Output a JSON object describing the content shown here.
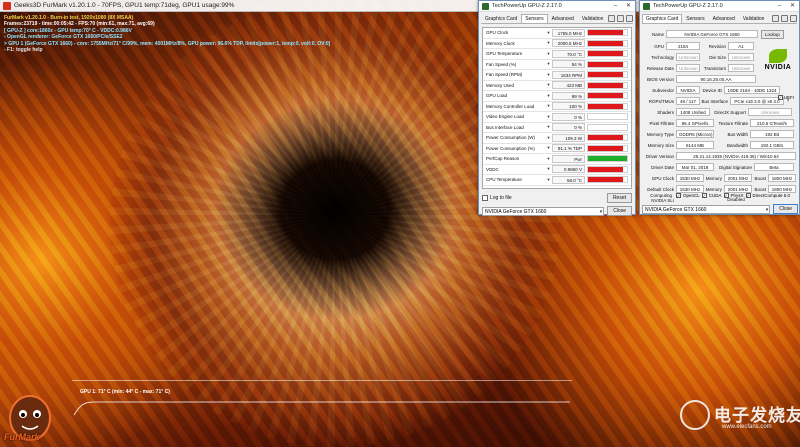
{
  "furmark": {
    "title": "Geeks3D FurMark v1.20.1.0 - 70FPS, GPU1 temp:71deg, GPU1 usage:99%",
    "overlay_lines": [
      "FurMark v1.20.1.0 - Burn-in test, 1920x1080 (8X MSAA)",
      "Frames:23719 - time:00:05:42 - FPS:70 (min:61, max:71, avg:69)",
      "[ GPU-Z ] core:1860z - GPU temp:70° C - VDDC:0.986V",
      "- OpenGL renderer: GeForce GTX 1660/PCIe/SSE2",
      "> GPU 1 (GeForce GTX 1660) - core: 1755MHz/71° C/99%, mem: 4001MHz/8%, GPU power: 96.6% TDP, limits[power:1, temp:0, volt:0, OV:0]",
      "- F1: toggle help"
    ],
    "temp_graph_label": "GPU 1: 71° C (min: 44° C - max: 71° C)",
    "logo_text": "FurMark"
  },
  "watermark": {
    "text": "电子发烧友",
    "url": "www.elecfans.com"
  },
  "sensors_window": {
    "title": "TechPowerUp GPU-Z 2.17.0",
    "tabs": [
      "Graphics Card",
      "Sensors",
      "Advanced",
      "Validation"
    ],
    "active_tab": "Sensors",
    "rows": [
      {
        "name": "GPU Clock",
        "value": "1755.0 MHz",
        "fill": 0.9
      },
      {
        "name": "Memory Clock",
        "value": "2000.5 MHz",
        "fill": 0.9
      },
      {
        "name": "GPU Temperature",
        "value": "70.0 °C",
        "fill": 0.9
      },
      {
        "name": "Fan Speed (%)",
        "value": "54 %",
        "fill": 0.9
      },
      {
        "name": "Fan Speed (RPM)",
        "value": "1634 RPM",
        "fill": 0.9
      },
      {
        "name": "Memory Used",
        "value": "423 MB",
        "fill": 0.9
      },
      {
        "name": "GPU Load",
        "value": "99 %",
        "fill": 0.9
      },
      {
        "name": "Memory Controller Load",
        "value": "100 %",
        "fill": 0.9
      },
      {
        "name": "Video Engine Load",
        "value": "0 %",
        "fill": 0
      },
      {
        "name": "Bus Interface Load",
        "value": "0 %",
        "fill": 0
      },
      {
        "name": "Power Consumption (W)",
        "value": "109.3 W",
        "fill": 0.9
      },
      {
        "name": "Power Consumption (%)",
        "value": "91.1 % TDP",
        "fill": 0.9
      },
      {
        "name": "PerfCap Reason",
        "value": "Pwr",
        "fill": 1,
        "color": "#1fae2a"
      },
      {
        "name": "VDDC",
        "value": "0.9860 V",
        "fill": 0.9
      },
      {
        "name": "CPU Temperature",
        "value": "58.0 °C",
        "fill": 0.9
      }
    ],
    "log_label": "Log to file",
    "reset_label": "Reset",
    "device": "NVIDIA GeForce GTX 1660",
    "close_label": "Close"
  },
  "gpuz_window": {
    "title": "TechPowerUp GPU-Z 2.17.0",
    "tabs": [
      "Graphics Card",
      "Sensors",
      "Advanced",
      "Validation"
    ],
    "active_tab": "Graphics Card",
    "name_label": "Name",
    "name_value": "NVIDIA GeForce GTX 1660",
    "lookup_label": "Lookup",
    "gpu_label": "GPU",
    "gpu_value": "2184",
    "revision_label": "Revision",
    "revision_value": "A1",
    "technology_label": "Technology",
    "technology_value": "Unknown",
    "die_size_label": "Die Size",
    "die_size_value": "Unknown",
    "release_label": "Release Date",
    "release_value": "Unknown",
    "transistors_label": "Transistors",
    "transistors_value": "Unknown",
    "bios_label": "BIOS Version",
    "bios_value": "90.16.25.00.AA",
    "uefi_label": "UEFI",
    "subvendor_label": "Subvendor",
    "subvendor_value": "NVIDIA",
    "device_id_label": "Device ID",
    "device_id_value": "10DE 2184 - 10DE 1324",
    "rops_label": "ROPs/TMUs",
    "rops_value": "48 / 117",
    "bus_label": "Bus Interface",
    "bus_value": "PCIe x16 3.0 @ x8 3.0",
    "bus_help": "?",
    "shaders_label": "Shaders",
    "shaders_value": "1408 Unified",
    "dx_label": "DirectX Support",
    "dx_value": "Unknown",
    "pixel_label": "Pixel Fillrate",
    "pixel_value": "86.4 GPixel/s",
    "texture_label": "Texture Fillrate",
    "texture_value": "210.6 GTexel/s",
    "memtype_label": "Memory Type",
    "memtype_value": "GDDR5 (Micron)",
    "buswidth_label": "Bus Width",
    "buswidth_value": "192 Bit",
    "memsize_label": "Memory Size",
    "memsize_value": "6144 MB",
    "bandwidth_label": "Bandwidth",
    "bandwidth_value": "192.1 GB/s",
    "driver_label": "Driver Version",
    "driver_value": "25.21.14.1935 (NVIDIA 419.35) / Win10 64",
    "driverdate_label": "Driver Date",
    "driverdate_value": "Mar 01, 2019",
    "signature_label": "Digital Signature",
    "signature_value": "Beta",
    "gpuclock_label": "GPU Clock",
    "gpuclock_value": "1530 MHz",
    "memory_label": "Memory",
    "memory_value": "2001 MHz",
    "boost_label": "Boost",
    "boost_value": "1800 MHz",
    "defclock_label": "Default Clock",
    "defclock_value": "1530 MHz",
    "defmemory_value": "2001 MHz",
    "defboost_value": "1800 MHz",
    "sli_label": "NVIDIA SLI",
    "sli_value": "Disabled",
    "computing_label": "Computing",
    "computing_items": [
      "OpenCL",
      "CUDA",
      "PhysX",
      "DirectCompute 5.0"
    ],
    "device": "NVIDIA GeForce GTX 1660",
    "close_label": "Close"
  },
  "colors": {
    "sensor_bar": "#e0181c",
    "perfcap_bar": "#1fae2a",
    "nvidia_green": "#76b900"
  }
}
